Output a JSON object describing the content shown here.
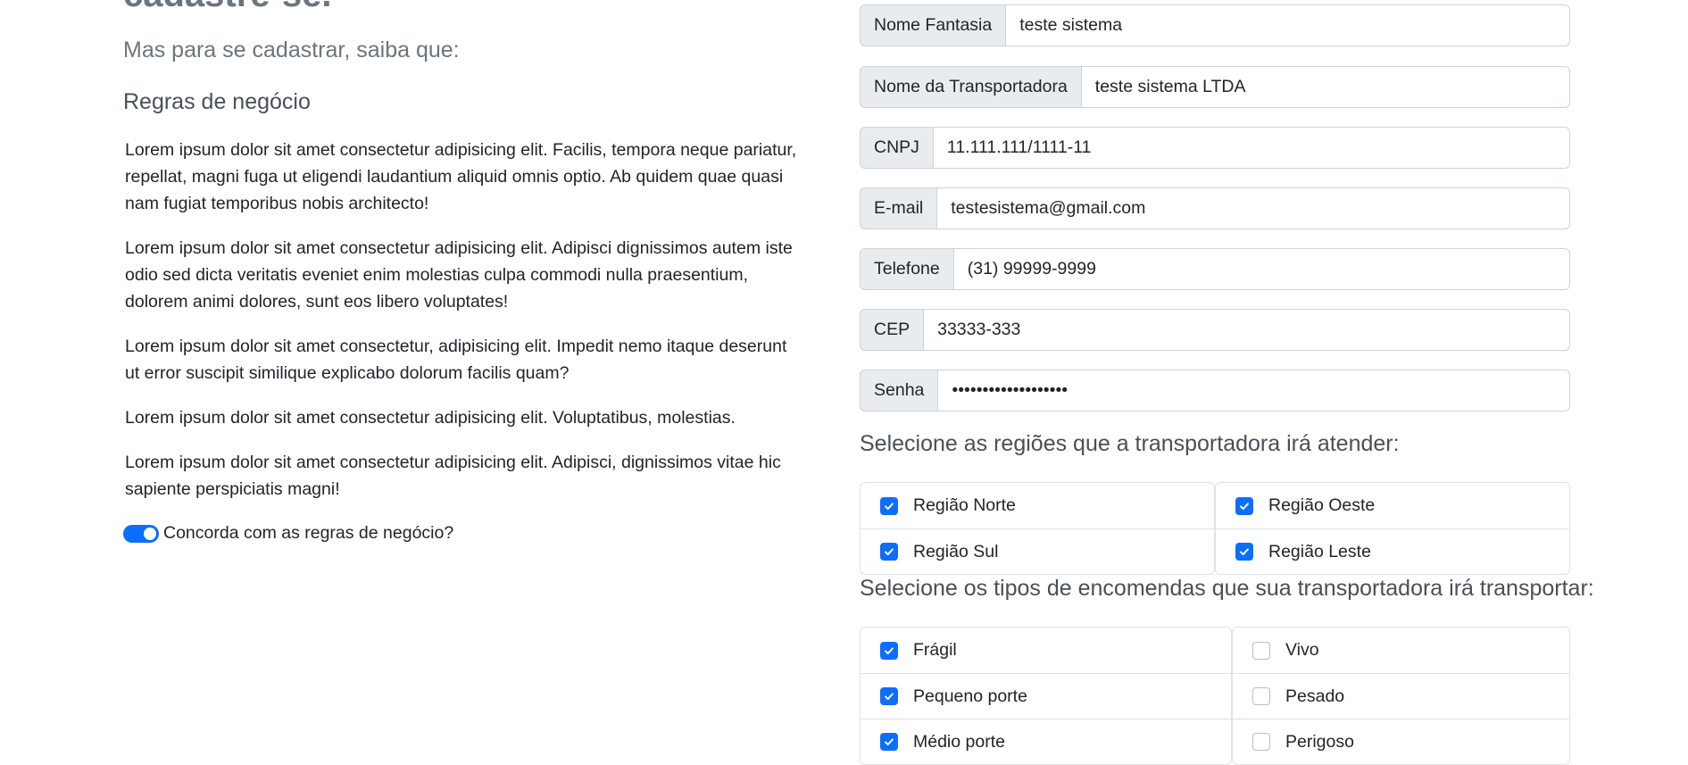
{
  "left": {
    "heading": "cadastre-se.",
    "lead": "Mas para se cadastrar, saiba que:",
    "rules_title": "Regras de negócio",
    "paragraphs": [
      "Lorem ipsum dolor sit amet consectetur adipisicing elit. Facilis, tempora neque pariatur, repellat, magni fuga ut eligendi laudantium aliquid omnis optio. Ab quidem quae quasi nam fugiat temporibus nobis architecto!",
      "Lorem ipsum dolor sit amet consectetur adipisicing elit. Adipisci dignissimos autem iste odio sed dicta veritatis eveniet enim molestias culpa commodi nulla praesentium, dolorem animi dolores, sunt eos libero voluptates!",
      "Lorem ipsum dolor sit amet consectetur, adipisicing elit. Impedit nemo itaque deserunt ut error suscipit similique explicabo dolorum facilis quam?",
      "Lorem ipsum dolor sit amet consectetur adipisicing elit. Voluptatibus, molestias.",
      "Lorem ipsum dolor sit amet consectetur adipisicing elit. Adipisci, dignissimos vitae hic sapiente perspiciatis magni!"
    ],
    "agree_label": "Concorda com as regras de negócio?",
    "agree_checked": true
  },
  "form": {
    "fields": [
      {
        "label": "Nome Fantasia",
        "value": "teste sistema"
      },
      {
        "label": "Nome da Transportadora",
        "value": "teste sistema LTDA"
      },
      {
        "label": "CNPJ",
        "value": "11.111.111/1111-11"
      },
      {
        "label": "E-mail",
        "value": "testesistema@gmail.com"
      },
      {
        "label": "Telefone",
        "value": "(31) 99999-9999"
      },
      {
        "label": "CEP",
        "value": "33333-333"
      },
      {
        "label": "Senha",
        "value": "•••••••••••••••••••"
      }
    ],
    "regions_title": "Selecione as regiões que a transportadora irá atender:",
    "regions": [
      {
        "label": "Região Norte",
        "checked": true
      },
      {
        "label": "Região Oeste",
        "checked": true
      },
      {
        "label": "Região Sul",
        "checked": true
      },
      {
        "label": "Região Leste",
        "checked": true
      }
    ],
    "types_title": "Selecione os tipos de encomendas que sua transportadora irá transportar:",
    "types_left": [
      {
        "label": "Frágil",
        "checked": true
      },
      {
        "label": "Pequeno porte",
        "checked": true
      },
      {
        "label": "Médio porte",
        "checked": true
      }
    ],
    "types_right": [
      {
        "label": "Vivo",
        "checked": false
      },
      {
        "label": "Pesado",
        "checked": false
      },
      {
        "label": "Perigoso",
        "checked": false
      }
    ]
  },
  "colors": {
    "accent": "#0d6efd",
    "muted_text": "#6c757d",
    "addon_bg": "#e9ecef",
    "border": "#ced4da"
  }
}
